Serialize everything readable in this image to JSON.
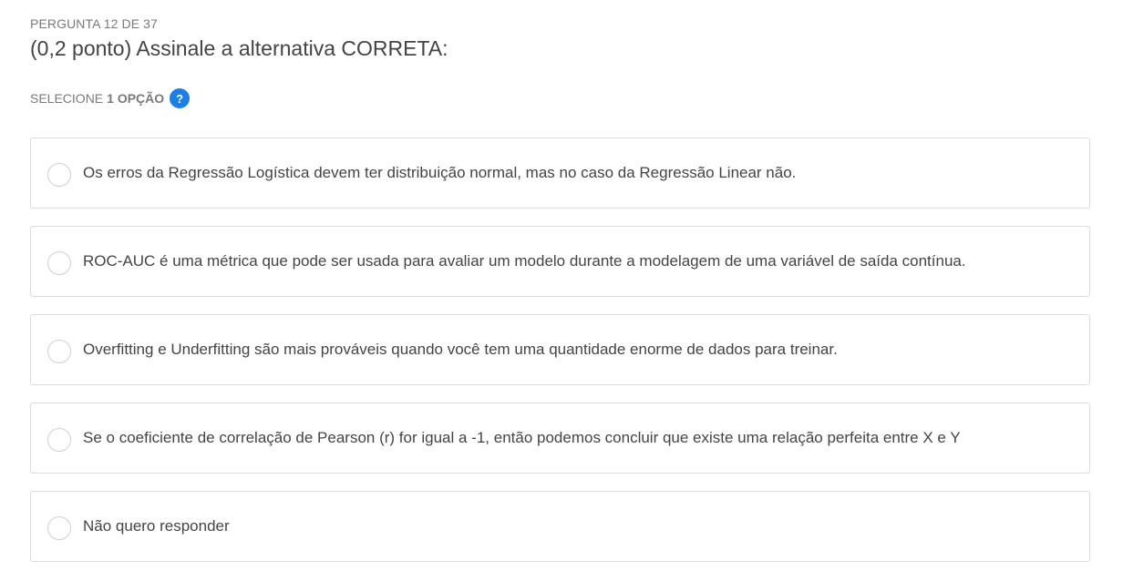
{
  "header": {
    "counter": "PERGUNTA 12 DE 37",
    "question": "(0,2 ponto) Assinale a alternativa CORRETA:"
  },
  "selection": {
    "prefix": "SELECIONE",
    "count": "1 OPÇÃO",
    "help_icon": "?",
    "accent_color": "#1a7fe8"
  },
  "options": [
    {
      "label": "Os erros da Regressão Logística devem ter distribuição normal, mas no caso da Regressão Linear não.",
      "selected": false
    },
    {
      "label": "ROC-AUC é uma métrica que pode ser usada para avaliar um modelo durante a modelagem de uma variável de saída contínua.",
      "selected": false
    },
    {
      "label": "Overfitting e Underfitting são mais prováveis quando você tem uma quantidade enorme de dados para treinar.",
      "selected": false
    },
    {
      "label": "Se o coeficiente de correlação de Pearson (r) for igual a -1, então podemos concluir que existe uma relação perfeita entre X e Y",
      "selected": false
    },
    {
      "label": "Não quero responder",
      "selected": false
    }
  ]
}
